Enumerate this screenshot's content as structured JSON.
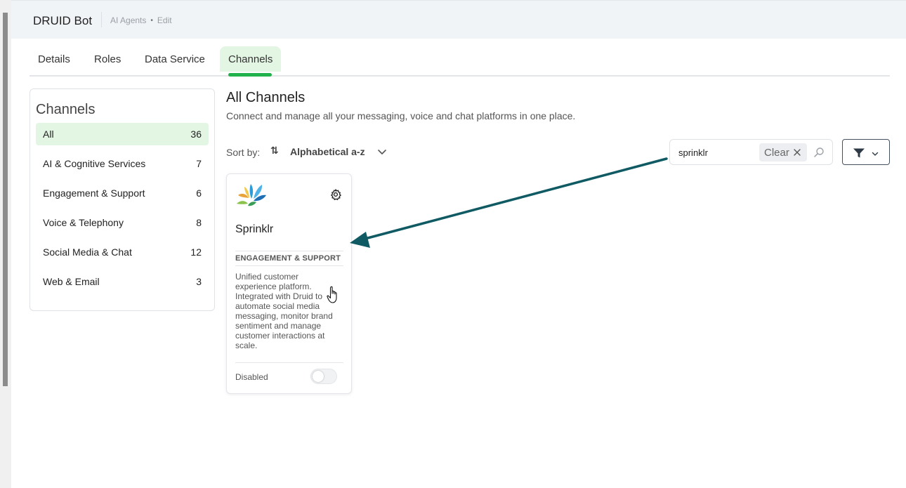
{
  "app": {
    "title": "DRUID Bot",
    "breadcrumb": [
      "AI Agents",
      "Edit"
    ],
    "breadcrumb_dot": "•"
  },
  "tabs": [
    {
      "label": "Details"
    },
    {
      "label": "Roles"
    },
    {
      "label": "Data Service"
    },
    {
      "label": "Channels",
      "active": true
    }
  ],
  "sidebar": {
    "title": "Channels",
    "items": [
      {
        "label": "All",
        "count": "36",
        "active": true
      },
      {
        "label": "AI & Cognitive Services",
        "count": "7"
      },
      {
        "label": "Engagement & Support",
        "count": "6"
      },
      {
        "label": "Voice & Telephony",
        "count": "8"
      },
      {
        "label": "Social Media & Chat",
        "count": "12"
      },
      {
        "label": "Web & Email",
        "count": "3"
      }
    ]
  },
  "main": {
    "title": "All Channels",
    "subtitle": "Connect and manage all your messaging, voice and chat platforms in one place.",
    "sort_label": "Sort by:",
    "sort_icon": "⇅",
    "sort_value": "Alphabetical a-z"
  },
  "search": {
    "value": "sprinklr",
    "clear_label": "Clear"
  },
  "cards": [
    {
      "name": "Sprinklr",
      "category": "ENGAGEMENT & SUPPORT",
      "description": "Unified customer experience platform. Integrated with Druid to automate social media messaging, monitor brand sentiment and manage customer interactions at scale.",
      "status": "Disabled",
      "enabled": false
    }
  ],
  "colors": {
    "accent_green": "#21b24b",
    "active_bg": "#e3f5e3",
    "annotation_arrow": "#0f5a63"
  },
  "icons": {
    "sort": "sort-az-icon",
    "chevron": "chevron-down-icon",
    "search": "search-icon",
    "filter": "filter-icon",
    "gear": "gear-icon",
    "clear": "close-icon"
  }
}
